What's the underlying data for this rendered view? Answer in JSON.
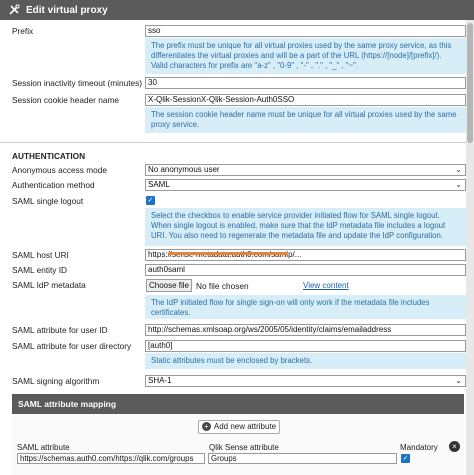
{
  "window": {
    "title": "Edit virtual proxy"
  },
  "fields": {
    "prefix_label": "Prefix",
    "prefix_value": "sso",
    "prefix_info": "The prefix must be unique for all virtual proxies used by the same proxy service, as this differentiates the virtual proxies and will be a part of the URL (https://[node]/[prefix]/). Valid characters for prefix are \"a-z\" , \"0-9\" , \"-\" , \".\" , \"_\" , \"~\".",
    "timeout_label": "Session inactivity timeout (minutes)",
    "timeout_value": "30",
    "cookie_label": "Session cookie header name",
    "cookie_value": "X-Qlik-SessionX-Qlik-Session-Auth0SSO",
    "cookie_info": "The session cookie header name must be unique for all virtual proxies used by the same proxy service."
  },
  "auth": {
    "section_title": "AUTHENTICATION",
    "anon_label": "Anonymous access mode",
    "anon_value": "No anonymous user",
    "method_label": "Authentication method",
    "method_value": "SAML",
    "logout_label": "SAML single logout",
    "logout_checked": true,
    "logout_info": "Select the checkbox to enable service provider initiated flow for SAML single logout. When single logout is enabled, make sure that the IdP metadata file includes a logout URI. You also need to regenerate the metadata file and update the IdP configuration.",
    "host_label": "SAML host URI",
    "host_value": "https://sense-metadata.auth0.com/samlp/...",
    "entity_label": "SAML entity ID",
    "entity_value": "auth0saml",
    "metadata_label": "SAML IdP metadata",
    "choose_file": "Choose file",
    "no_file": "No file chosen",
    "view_content": "View content",
    "metadata_info": "The IdP initiated flow for single sign-on will only work if the metadata file includes certificates.",
    "userid_label": "SAML attribute for user ID",
    "userid_value": "http://schemas.xmlsoap.org/ws/2005/05/identity/claims/emailaddress",
    "userdir_label": "SAML attribute for user directory",
    "userdir_value": "[auth0]",
    "userdir_info": "Static attributes must be enclosed by brackets.",
    "signing_label": "SAML signing algorithm",
    "signing_value": "SHA-1"
  },
  "mapping": {
    "title": "SAML attribute mapping",
    "add_label": "Add new attribute",
    "col_saml": "SAML attribute",
    "col_sense": "Qlik Sense attribute",
    "col_mandatory": "Mandatory",
    "row_saml": "https://schemas.auth0.com/https://qlik.com/groups",
    "row_sense": "Groups",
    "row_mandatory": true
  },
  "colors": {
    "titlebar": "#5a5a5a",
    "info_bg": "#d7eef9",
    "info_text": "#2b6ea3",
    "checkbox": "#1a73c7",
    "link": "#1a5fb4"
  }
}
